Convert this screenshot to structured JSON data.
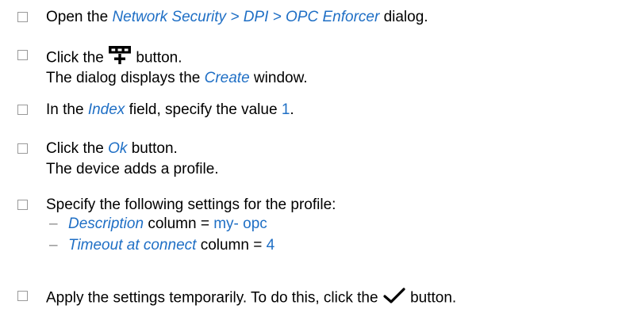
{
  "steps": [
    {
      "prefix": "Open the ",
      "link": "Network Security > DPI > OPC Enforcer",
      "suffix": " dialog."
    },
    {
      "prefix": "Click the ",
      "suffix": " button.",
      "note": "The dialog displays the ",
      "note_link": "Create",
      "note_suffix": " window."
    },
    {
      "prefix": "In the ",
      "link": "Index",
      "middle": " field, specify the value ",
      "value": "1",
      "suffix": "."
    },
    {
      "prefix": "Click the ",
      "link": "Ok",
      "suffix": " button.",
      "note": "The device adds a profile."
    },
    {
      "text": "Specify the following settings for the profile:",
      "items": [
        {
          "label": "Description",
          "middle": " column = ",
          "value": "my- opc"
        },
        {
          "label": "Timeout at connect",
          "middle": " column = ",
          "value": "4"
        }
      ]
    },
    {
      "prefix": "Apply the settings temporarily. To do this, click the ",
      "suffix": " button."
    }
  ],
  "icons": {
    "add": "add-table-row-icon",
    "apply": "checkmark-icon"
  }
}
